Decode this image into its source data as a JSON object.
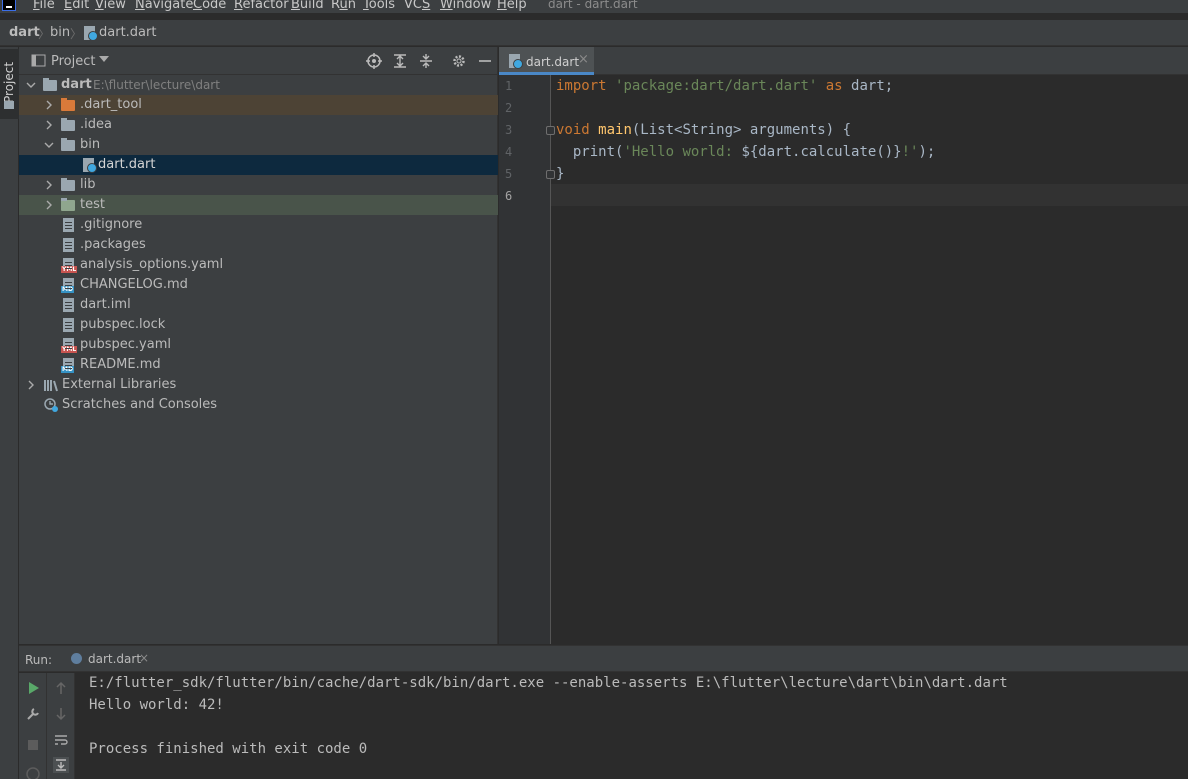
{
  "menubar": {
    "items": [
      {
        "label": "File",
        "ul": "F",
        "rest": "ile"
      },
      {
        "label": "Edit",
        "ul": "E",
        "rest": "dit"
      },
      {
        "label": "View",
        "ul": "V",
        "rest": "iew"
      },
      {
        "label": "Navigate",
        "ul": "N",
        "rest": "avigate"
      },
      {
        "label": "Code",
        "ul": "C",
        "rest": "ode"
      },
      {
        "label": "Refactor",
        "ul": "R",
        "rest": "efactor"
      },
      {
        "label": "Build",
        "ul": "B",
        "rest": "uild"
      },
      {
        "label": "Run",
        "pre": "R",
        "ul": "u",
        "rest": "n"
      },
      {
        "label": "Tools",
        "ul": "T",
        "rest": "ools"
      },
      {
        "label": "VCS",
        "pre": "VC",
        "ul": "S",
        "rest": ""
      },
      {
        "label": "Window",
        "ul": "W",
        "rest": "indow"
      },
      {
        "label": "Help",
        "ul": "H",
        "rest": "elp"
      }
    ],
    "window_title": "dart - dart.dart"
  },
  "breadcrumb": {
    "items": [
      "dart",
      "bin",
      "dart.dart"
    ]
  },
  "sidebar": {
    "tab_label": "Project"
  },
  "project_panel": {
    "title": "Project",
    "root": {
      "name": "dart",
      "path": "E:\\flutter\\lecture\\dart"
    },
    "items": [
      {
        "name": ".dart_tool",
        "kind": "folder-excluded",
        "expandable": true
      },
      {
        "name": ".idea",
        "kind": "folder",
        "expandable": true
      },
      {
        "name": "bin",
        "kind": "folder",
        "expandable": true,
        "expanded": true
      },
      {
        "name": "dart.dart",
        "kind": "dart-file",
        "selected": true
      },
      {
        "name": "lib",
        "kind": "folder",
        "expandable": true
      },
      {
        "name": "test",
        "kind": "folder-test",
        "expandable": true
      },
      {
        "name": ".gitignore",
        "kind": "file"
      },
      {
        "name": ".packages",
        "kind": "file"
      },
      {
        "name": "analysis_options.yaml",
        "kind": "yaml"
      },
      {
        "name": "CHANGELOG.md",
        "kind": "md"
      },
      {
        "name": "dart.iml",
        "kind": "file"
      },
      {
        "name": "pubspec.lock",
        "kind": "file"
      },
      {
        "name": "pubspec.yaml",
        "kind": "yaml"
      },
      {
        "name": "README.md",
        "kind": "md"
      },
      {
        "name": "External Libraries",
        "kind": "libraries",
        "expandable": true
      },
      {
        "name": "Scratches and Consoles",
        "kind": "scratches"
      }
    ]
  },
  "editor": {
    "tab_label": "dart.dart",
    "line_numbers": [
      "1",
      "2",
      "3",
      "4",
      "5",
      "6"
    ],
    "code": {
      "l1_kw": "import",
      "l1_str": "'package:dart/dart.dart'",
      "l1_as": "as",
      "l1_rest": "dart;",
      "l3_kw": "void",
      "l3_fn": "main",
      "l3_rest": "(List<String> arguments) {",
      "l4_a": "  print(",
      "l4_str": "'Hello world: ",
      "l4_interp": "${dart.calculate()}",
      "l4_str2": "!'",
      "l4_end": ");",
      "l5": "}"
    }
  },
  "run_panel": {
    "label": "Run:",
    "tab_label": "dart.dart",
    "output": [
      "E:/flutter_sdk/flutter/bin/cache/dart-sdk/bin/dart.exe --enable-asserts E:\\flutter\\lecture\\dart\\bin\\dart.dart",
      "Hello world: 42!",
      "",
      "Process finished with exit code 0"
    ]
  },
  "colors": {
    "accent": "#4a88c7",
    "keyword": "#cc7832",
    "string": "#6a8759",
    "function": "#ffc66d",
    "selected_row": "#0d293e",
    "excluded_row": "#4d4335",
    "test_row": "#49544a"
  }
}
